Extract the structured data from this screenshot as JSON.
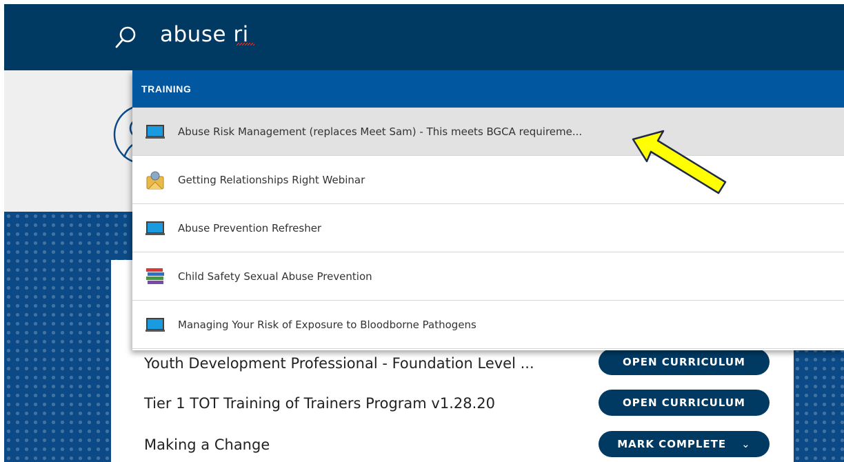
{
  "search": {
    "query": "abuse ri",
    "icon": "search-icon"
  },
  "dropdown": {
    "header": "TRAINING",
    "items": [
      {
        "label": "Abuse Risk Management (replaces Meet Sam) - This meets BGCA requireme...",
        "icon": "laptop-icon",
        "highlighted": true
      },
      {
        "label": "Getting Relationships Right Webinar",
        "icon": "webinar-icon",
        "highlighted": false
      },
      {
        "label": "Abuse Prevention Refresher",
        "icon": "laptop-icon",
        "highlighted": false
      },
      {
        "label": "Child Safety Sexual Abuse Prevention",
        "icon": "books-icon",
        "highlighted": false
      },
      {
        "label": "Managing Your Risk of Exposure to Bloodborne Pathogens",
        "icon": "laptop-icon",
        "highlighted": false
      }
    ]
  },
  "curricula": [
    {
      "title": "Youth Development Professional - Foundation Level ...",
      "action": "OPEN CURRICULUM"
    },
    {
      "title": "Tier 1 TOT Training of Trainers Program v1.28.20",
      "action": "OPEN CURRICULUM"
    },
    {
      "title": "Making a Change",
      "action": "MARK COMPLETE"
    }
  ],
  "colors": {
    "topbar": "#003a63",
    "dropdown_header": "#0258a0",
    "highlight_row": "#e2e2e2",
    "button": "#003a63",
    "annotation_arrow": "#ffff00"
  }
}
